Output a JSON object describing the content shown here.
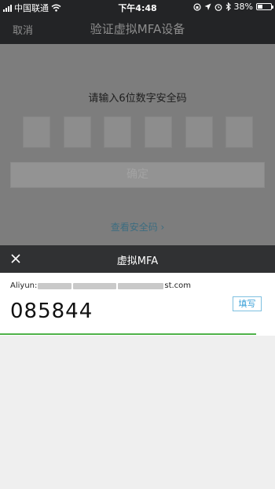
{
  "status_bar": {
    "carrier": "中国联通",
    "time": "下午4:48",
    "battery": "38%",
    "battery_level": 0.38
  },
  "nav": {
    "cancel_label": "取消",
    "title": "验证虚拟MFA设备"
  },
  "page": {
    "prompt": "请输入6位数字安全码",
    "digit_boxes": 6,
    "confirm_label": "确定",
    "view_code_link": "查看安全码 ›"
  },
  "sheet": {
    "title": "虚拟MFA",
    "account_prefix": "Aliyun:",
    "account_suffix": "st.com",
    "code": "085844",
    "fill_label": "填写",
    "time_remaining_fraction": 0.93
  },
  "colors": {
    "accent_green": "#4fb24a",
    "link_blue": "#3aa0d8"
  }
}
